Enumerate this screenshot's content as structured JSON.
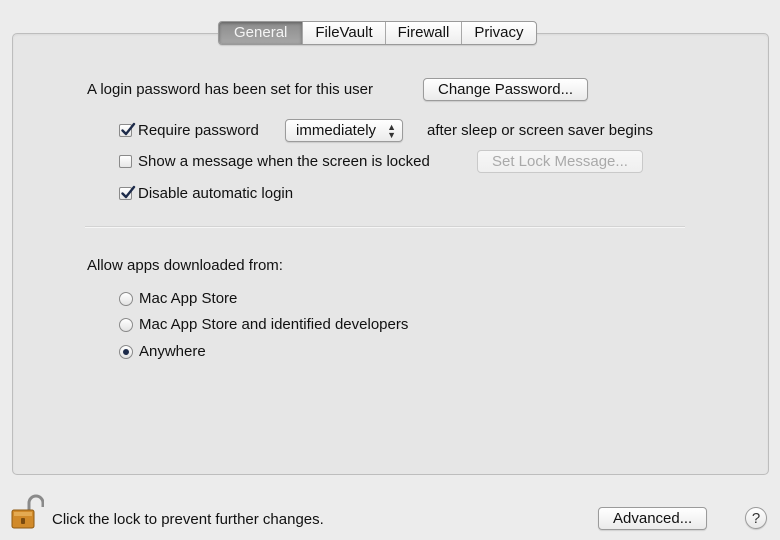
{
  "tabs": [
    {
      "label": "General",
      "active": true
    },
    {
      "label": "FileVault",
      "active": false
    },
    {
      "label": "Firewall",
      "active": false
    },
    {
      "label": "Privacy",
      "active": false
    }
  ],
  "login": {
    "text": "A login password has been set for this user",
    "change_button": "Change Password..."
  },
  "options": {
    "require_password": {
      "label": "Require password",
      "checked": true
    },
    "require_popup_value": "immediately",
    "require_suffix": "after sleep or screen saver begins",
    "show_message": {
      "label": "Show a message when the screen is locked",
      "checked": false
    },
    "set_lock_button": "Set Lock Message...",
    "disable_autologin": {
      "label": "Disable automatic login",
      "checked": true
    }
  },
  "allow_apps": {
    "label": "Allow apps downloaded from:",
    "choices": [
      {
        "label": "Mac App Store",
        "selected": false
      },
      {
        "label": "Mac App Store and identified developers",
        "selected": false
      },
      {
        "label": "Anywhere",
        "selected": true
      }
    ]
  },
  "footer": {
    "lock_text": "Click the lock to prevent further changes.",
    "advanced_button": "Advanced...",
    "help_glyph": "?"
  },
  "icons": {
    "lock": "lock-open-icon",
    "check": "checkmark-icon",
    "popup_arrows": "up-down-arrows-icon",
    "help": "help-icon"
  },
  "colors": {
    "window_bg": "#ececec",
    "active_tab": "#8c8c8c",
    "checkmark": "#1d2b4a",
    "lock_gold": "#d18a2a"
  }
}
